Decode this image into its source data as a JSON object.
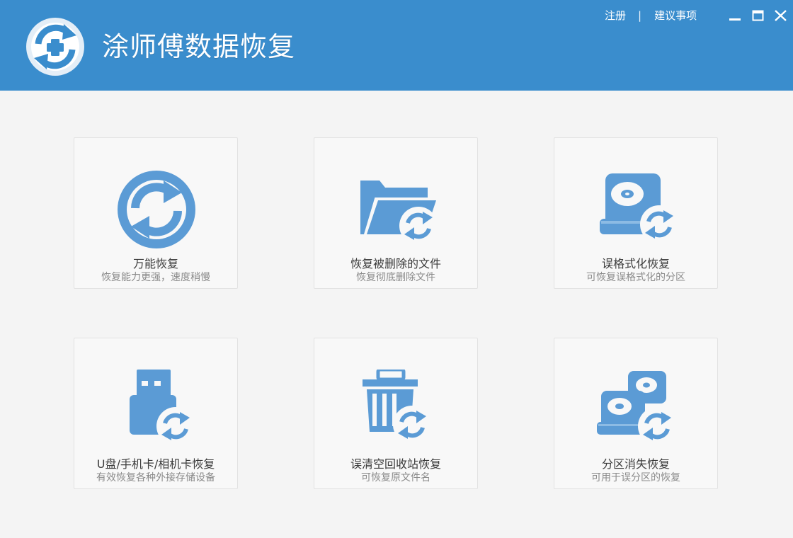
{
  "app": {
    "title": "涂师傅数据恢复",
    "brand_color": "#3a8dcd",
    "icon_color": "#5b9bd5"
  },
  "top_links": {
    "register": "注册",
    "separator": "|",
    "suggestions": "建议事项"
  },
  "window_controls": [
    "minimize-icon",
    "maximize-icon",
    "close-icon"
  ],
  "cards": [
    {
      "icon": "refresh-circle-icon",
      "title": "万能恢复",
      "desc": "恢复能力更强，速度稍慢"
    },
    {
      "icon": "folder-restore-icon",
      "title": "恢复被删除的文件",
      "desc": "恢复彻底删除文件"
    },
    {
      "icon": "disk-restore-icon",
      "title": "误格式化恢复",
      "desc": "可恢复误格式化的分区"
    },
    {
      "icon": "usb-restore-icon",
      "title": "U盘/手机卡/相机卡恢复",
      "desc": "有效恢复各种外接存储设备"
    },
    {
      "icon": "recycle-bin-restore-icon",
      "title": "误清空回收站恢复",
      "desc": "可恢复原文件名"
    },
    {
      "icon": "partition-restore-icon",
      "title": "分区消失恢复",
      "desc": "可用于误分区的恢复"
    }
  ]
}
